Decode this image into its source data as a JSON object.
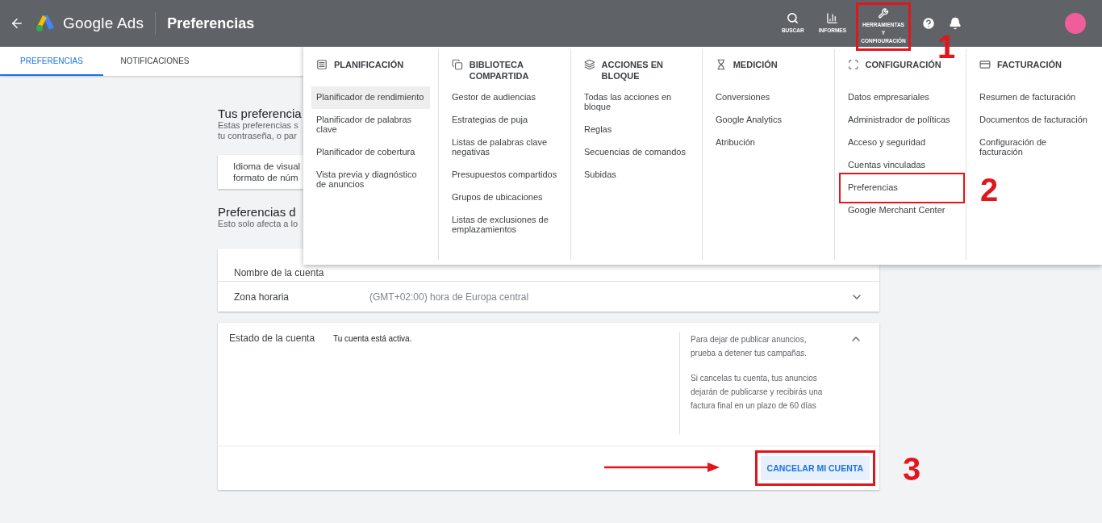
{
  "header": {
    "product": "Google Ads",
    "page_title": "Preferencias",
    "actions": [
      {
        "kind": "search",
        "label": "BUSCAR",
        "highlighted": false
      },
      {
        "kind": "reports",
        "label": "INFORMES",
        "highlighted": false
      },
      {
        "kind": "tools",
        "label": "HERRAMIENTAS Y CONFIGURACIÓN",
        "highlighted": true,
        "annotation": "1"
      },
      {
        "kind": "help"
      },
      {
        "kind": "notifications"
      }
    ]
  },
  "tabs": [
    {
      "label": "PREFERENCIAS",
      "selected": true
    },
    {
      "label": "NOTIFICACIONES",
      "selected": false
    }
  ],
  "user_prefs": {
    "title": "Tus preferencia",
    "description_lines": [
      "Estas preferencias s",
      "tu contraseña, o par"
    ],
    "card_lines": [
      "Idioma de visual",
      "formato de núm"
    ]
  },
  "account_prefs": {
    "title": "Preferencias d",
    "description": "Esto solo afecta a lo",
    "rows": [
      {
        "label": "Nombre de la cuenta"
      },
      {
        "label": "Zona horaria",
        "value": "(GMT+02:00) hora de Europa central",
        "expanded": false
      }
    ]
  },
  "status_card": {
    "label": "Estado de la cuenta",
    "value": "Tu cuenta está activa.",
    "expanded": true,
    "notes": [
      "Para dejar de publicar anuncios, prueba a detener tus campañas.",
      "Si cancelas tu cuenta, tus anuncios dejarán de publicarse y recibirás una factura final en un plazo de 60 días"
    ],
    "button": {
      "label": "CANCELAR MI CUENTA",
      "highlighted": true,
      "annotation": "3",
      "arrow": true
    }
  },
  "menu": {
    "columns": [
      {
        "kind": "planning",
        "title": "PLANIFICACIÓN",
        "items": [
          {
            "label": "Planificador de rendimiento",
            "selected": true,
            "highlighted": false
          },
          {
            "label": "Planificador de palabras clave",
            "selected": false,
            "highlighted": false
          },
          {
            "label": "Planificador de cobertura",
            "selected": false,
            "highlighted": false
          },
          {
            "label": "Vista previa y diagnóstico de anuncios",
            "selected": false,
            "highlighted": false
          }
        ]
      },
      {
        "kind": "library",
        "title": "BIBLIOTECA COMPARTIDA",
        "items": [
          {
            "label": "Gestor de audiencias",
            "selected": false,
            "highlighted": false
          },
          {
            "label": "Estrategias de puja",
            "selected": false,
            "highlighted": false
          },
          {
            "label": "Listas de palabras clave negativas",
            "selected": false,
            "highlighted": false
          },
          {
            "label": "Presupuestos compartidos",
            "selected": false,
            "highlighted": false
          },
          {
            "label": "Grupos de ubicaciones",
            "selected": false,
            "highlighted": false
          },
          {
            "label": "Listas de exclusiones de emplazamientos",
            "selected": false,
            "highlighted": false
          }
        ]
      },
      {
        "kind": "bulk",
        "title": "ACCIONES EN BLOQUE",
        "items": [
          {
            "label": "Todas las acciones en bloque",
            "selected": false,
            "highlighted": false
          },
          {
            "label": "Reglas",
            "selected": false,
            "highlighted": false
          },
          {
            "label": "Secuencias de comandos",
            "selected": false,
            "highlighted": false
          },
          {
            "label": "Subidas",
            "selected": false,
            "highlighted": false
          }
        ]
      },
      {
        "kind": "measurement",
        "title": "MEDICIÓN",
        "items": [
          {
            "label": "Conversiones",
            "selected": false,
            "highlighted": false
          },
          {
            "label": "Google Analytics",
            "selected": false,
            "highlighted": false
          },
          {
            "label": "Atribución",
            "selected": false,
            "highlighted": false
          }
        ]
      },
      {
        "kind": "setup",
        "title": "CONFIGURACIÓN",
        "items": [
          {
            "label": "Datos empresariales",
            "selected": false,
            "highlighted": false
          },
          {
            "label": "Administrador de políticas",
            "selected": false,
            "highlighted": false
          },
          {
            "label": "Acceso y seguridad",
            "selected": false,
            "highlighted": false
          },
          {
            "label": "Cuentas vinculadas",
            "selected": false,
            "highlighted": false
          },
          {
            "label": "Preferencias",
            "selected": false,
            "highlighted": true,
            "annotation": "2"
          },
          {
            "label": "Google Merchant Center",
            "selected": false,
            "highlighted": false
          }
        ]
      },
      {
        "kind": "billing",
        "title": "FACTURACIÓN",
        "items": [
          {
            "label": "Resumen de facturación",
            "selected": false,
            "highlighted": false
          },
          {
            "label": "Documentos de facturación",
            "selected": false,
            "highlighted": false
          },
          {
            "label": "Configuración de facturación",
            "selected": false,
            "highlighted": false
          }
        ]
      }
    ]
  }
}
